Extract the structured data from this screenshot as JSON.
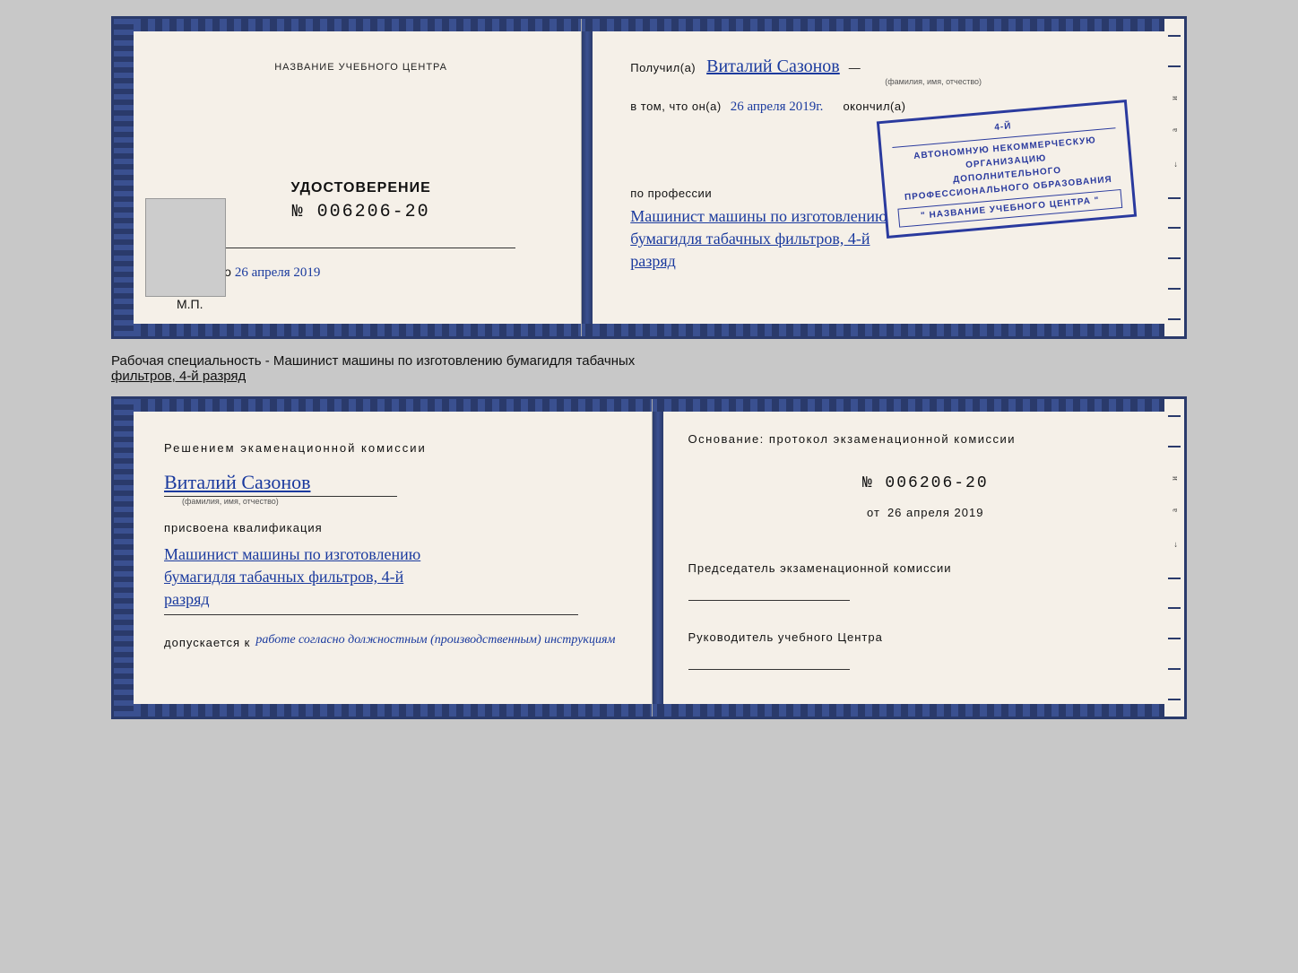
{
  "top_document": {
    "left_page": {
      "heading": "НАЗВАНИЕ УЧЕБНОГО ЦЕНТРА",
      "cert_label": "УДОСТОВЕРЕНИЕ",
      "cert_number": "№ 006206-20",
      "issued_label": "Выдано",
      "issued_date": "26 апреля 2019",
      "mp_label": "М.П."
    },
    "right_page": {
      "recipient_prefix": "Получил(а)",
      "recipient_name": "Виталий Сазонов",
      "recipient_sub": "(фамилия, имя, отчество)",
      "date_prefix": "в том, что он(а)",
      "date_value": "26 апреля 2019г.",
      "date_suffix": "окончил(а)",
      "stamp_lines": [
        "Автономную некоммерческую организацию",
        "дополнительного профессионального образования",
        "\" НАЗВАНИЕ УЧЕБНОГО ЦЕНТРА \""
      ],
      "profession_prefix": "по профессии",
      "profession_line1": "Машинист машины по изготовлению",
      "profession_line2": "бумагидля табачных фильтров, 4-й",
      "profession_line3": "разряд"
    }
  },
  "caption": {
    "text1": "Рабочая специальность - Машинист машины по изготовлению бумагидля табачных",
    "text2": "фильтров, 4-й разряд"
  },
  "bottom_document": {
    "left_page": {
      "heading": "Решением экаменационной комиссии",
      "person_name": "Виталий Сазонов",
      "person_sub": "(фамилия, имя, отчество)",
      "qualification_prefix": "присвоена квалификация",
      "qualification_line1": "Машинист машины по изготовлению",
      "qualification_line2": "бумагидля табачных фильтров, 4-й",
      "qualification_line3": "разряд",
      "admission_prefix": "допускается к",
      "admission_text": "работе согласно должностным (производственным) инструкциям"
    },
    "right_page": {
      "basis_label": "Основание: протокол экзаменационной комиссии",
      "protocol_number": "№  006206-20",
      "protocol_date_prefix": "от",
      "protocol_date": "26 апреля 2019",
      "chairman_label": "Председатель экзаменационной комиссии",
      "center_head_label": "Руководитель учебного Центра"
    }
  }
}
